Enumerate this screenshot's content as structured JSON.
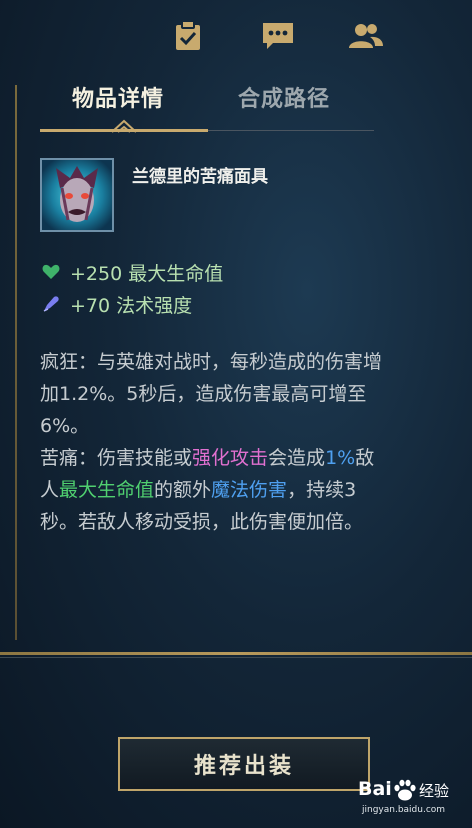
{
  "topbar": {
    "icons": [
      "clipboard-check-icon",
      "chat-icon",
      "friends-icon"
    ]
  },
  "tabs": [
    {
      "label": "物品详情",
      "active": true
    },
    {
      "label": "合成路径",
      "active": false
    }
  ],
  "item": {
    "name": "兰德里的苦痛面具",
    "icon": "liandry-mask-icon"
  },
  "stats": [
    {
      "text": "+250 最大生命值",
      "icon": "heart-icon"
    },
    {
      "text": "+70 法术强度",
      "icon": "ability-power-icon"
    }
  ],
  "description": {
    "madness_label": "疯狂：",
    "madness_text": "与英雄对战时，每秒造成的伤害增加1.2%。5秒后，造成伤害最高可增至6%。",
    "torment_label": "苦痛：",
    "torment_1": "伤害技能或",
    "torment_kw_empowered": "强化攻击",
    "torment_2": "会造成",
    "torment_kw_percent": "1%",
    "torment_3": "敌人",
    "torment_kw_maxhp": "最大生命值",
    "torment_4": "的额外",
    "torment_kw_magic": "魔法伤害",
    "torment_5": "，持续3秒。若敌人移动受损，此伤害便加倍。"
  },
  "footer": {
    "recommend_button": "推荐出装"
  },
  "watermark": {
    "brand": "Bai",
    "brand_suffix": "经验",
    "url": "jingyan.baidu.com"
  },
  "colors": {
    "gold": "#c8aa6e",
    "keyword_pink": "#e070d0",
    "keyword_blue": "#4fa0f0",
    "keyword_green": "#50d070",
    "stat_green": "#b8e0b0"
  }
}
